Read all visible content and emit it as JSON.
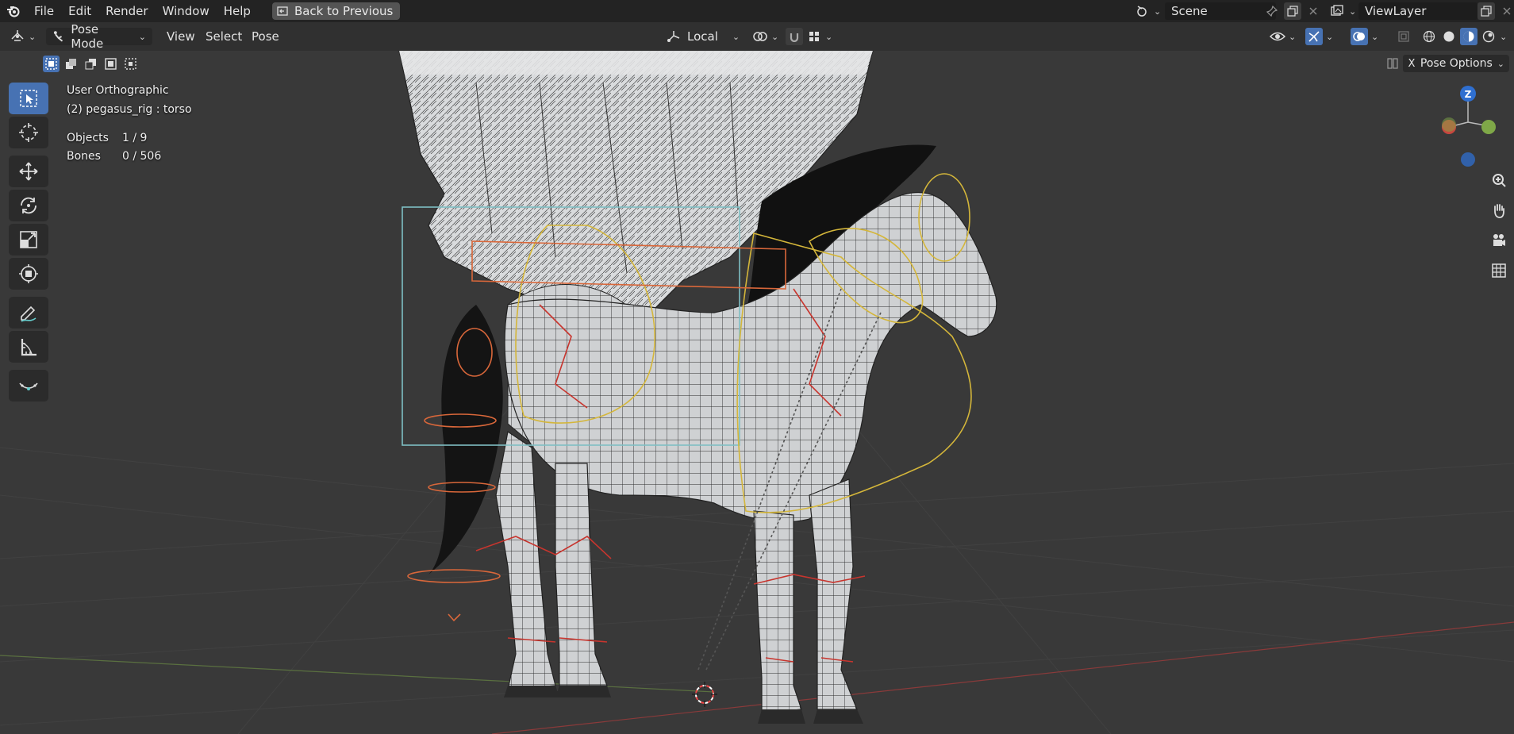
{
  "topbar": {
    "menus": [
      "File",
      "Edit",
      "Render",
      "Window",
      "Help"
    ],
    "back_label": "Back to Previous",
    "scene_name": "Scene",
    "view_layer": "ViewLayer"
  },
  "header": {
    "mode_label": "Pose Mode",
    "menus": [
      "View",
      "Select",
      "Pose"
    ],
    "orientation": "Local"
  },
  "viewport": {
    "view_name": "User Orthographic",
    "active_object": "(2) pegasus_rig : torso",
    "stats": [
      {
        "label": "Objects",
        "value": "1 / 9"
      },
      {
        "label": "Bones",
        "value": "0 / 506"
      }
    ],
    "pose_options_label": "Pose Options",
    "x_toggle": "X",
    "gizmo_axis": "Z"
  },
  "toolbar": {
    "tools": [
      "select-box",
      "cursor",
      "move",
      "rotate",
      "scale",
      "transform",
      "annotate",
      "measure",
      "relax"
    ]
  },
  "colors": {
    "active": "#4772b3",
    "bone_red": "#c8352e",
    "bone_yellow": "#d4b63a",
    "bone_orange": "#d9673a",
    "bone_cyan": "#7fbfc4"
  }
}
